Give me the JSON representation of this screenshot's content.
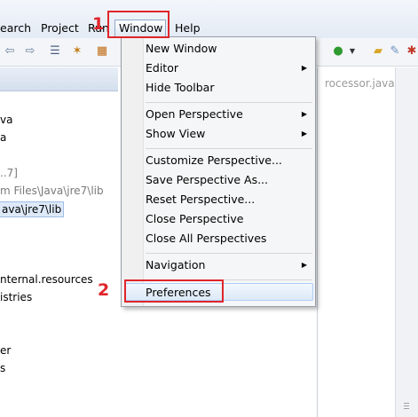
{
  "menubar": {
    "items": [
      {
        "label": "earch"
      },
      {
        "label": "Project"
      },
      {
        "label": "Run"
      },
      {
        "label": "Window"
      },
      {
        "label": "Help"
      }
    ]
  },
  "left_panel": {
    "lines": [
      "va",
      "a",
      "..7]",
      "m Files\\Java\\jre7\\lib",
      "ava\\jre7\\lib",
      "nternal.resources",
      "istries",
      "er",
      "s"
    ]
  },
  "right_panel": {
    "tab_label": "rocessor.java"
  },
  "window_menu": {
    "groups": [
      [
        {
          "label": "New Window",
          "submenu": false
        },
        {
          "label": "Editor",
          "submenu": true
        },
        {
          "label": "Hide Toolbar",
          "submenu": false
        }
      ],
      [
        {
          "label": "Open Perspective",
          "submenu": true
        },
        {
          "label": "Show View",
          "submenu": true
        }
      ],
      [
        {
          "label": "Customize Perspective...",
          "submenu": false
        },
        {
          "label": "Save Perspective As...",
          "submenu": false
        },
        {
          "label": "Reset Perspective...",
          "submenu": false
        },
        {
          "label": "Close Perspective",
          "submenu": false
        },
        {
          "label": "Close All Perspectives",
          "submenu": false
        }
      ],
      [
        {
          "label": "Navigation",
          "submenu": true
        }
      ],
      [
        {
          "label": "Preferences",
          "submenu": false
        }
      ]
    ],
    "highlighted": "Preferences"
  },
  "annotations": {
    "step1": "1",
    "step2": "2",
    "color": "#e0252b"
  },
  "toolbar": {
    "icons": [
      "back-icon",
      "forward-icon",
      "list-icon",
      "wand-icon",
      "package-icon",
      "run-icon",
      "dropdown-icon",
      "open-folder-icon",
      "edit-icon",
      "debug-icon"
    ]
  }
}
